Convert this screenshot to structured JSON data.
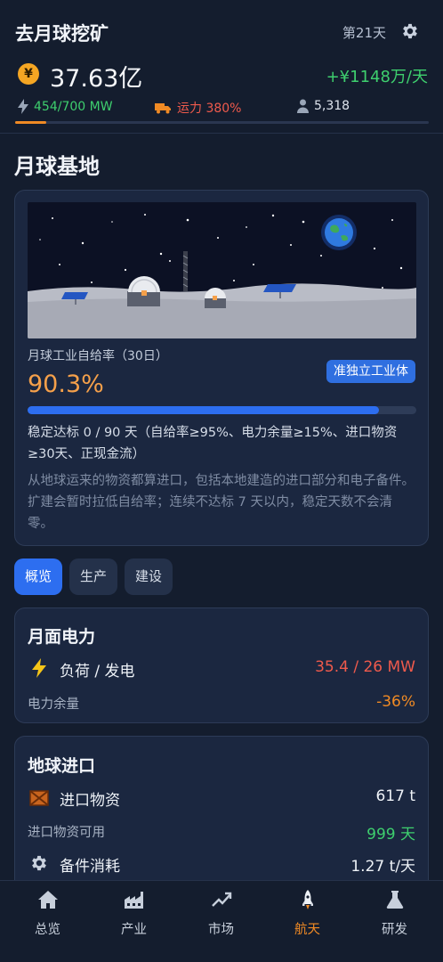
{
  "header": {
    "app_title": "去月球挖矿",
    "day": "第21天",
    "settings_icon": "gear-icon",
    "currency_icon": "yen-coin-icon",
    "currency_symbol": "¥",
    "money": "37.63亿",
    "income": "+¥1148万/天",
    "power_icon": "lightning-icon",
    "power": "454/700 MW",
    "transport_icon": "truck-icon",
    "transport": "运力 380%",
    "population_icon": "person-icon",
    "population": "5,318",
    "top_progress": 0.075,
    "colors": {
      "green": "#3ecf6e",
      "red": "#ef5a4c",
      "orange": "#f08a24"
    }
  },
  "base": {
    "section_title": "月球基地",
    "scene_icon": "moon-base-illustration",
    "rate_label": "月球工业自给率（30日）",
    "rate_value": "90.3%",
    "rate_fraction": 0.903,
    "badge": "准独立工业体",
    "goal_text": "稳定达标 0 / 90 天（自给率≥95%、电力余量≥15%、进口物资≥30天、正现金流）",
    "note_text": "从地球运来的物资都算进口，包括本地建造的进口部分和电子备件。扩建会暂时拉低自给率；连续不达标 7 天以内，稳定天数不会清零。"
  },
  "tabs": [
    {
      "label": "概览",
      "active": true
    },
    {
      "label": "生产",
      "active": false
    },
    {
      "label": "建设",
      "active": false
    }
  ],
  "power_card": {
    "title": "月面电力",
    "load_icon": "lightning-icon",
    "load_label": "负荷 / 发电",
    "load_value": "35.4 / 26 MW",
    "margin_label": "电力余量",
    "margin_value": "-36%"
  },
  "import_card": {
    "title": "地球进口",
    "goods_icon": "crate-icon",
    "goods_label": "进口物资",
    "goods_value": "617 t",
    "days_label": "进口物资可用",
    "days_value": "999 天",
    "parts_icon": "gear-icon",
    "parts_label": "件消耗",
    "parts_prefix": "备",
    "parts_value": "1.27 t/天"
  },
  "bottom_nav": [
    {
      "label": "总览",
      "icon": "home-icon"
    },
    {
      "label": "产业",
      "icon": "factory-icon"
    },
    {
      "label": "市场",
      "icon": "trend-icon"
    },
    {
      "label": "航天",
      "icon": "rocket-icon",
      "active": true
    },
    {
      "label": "研发",
      "icon": "flask-icon"
    }
  ]
}
